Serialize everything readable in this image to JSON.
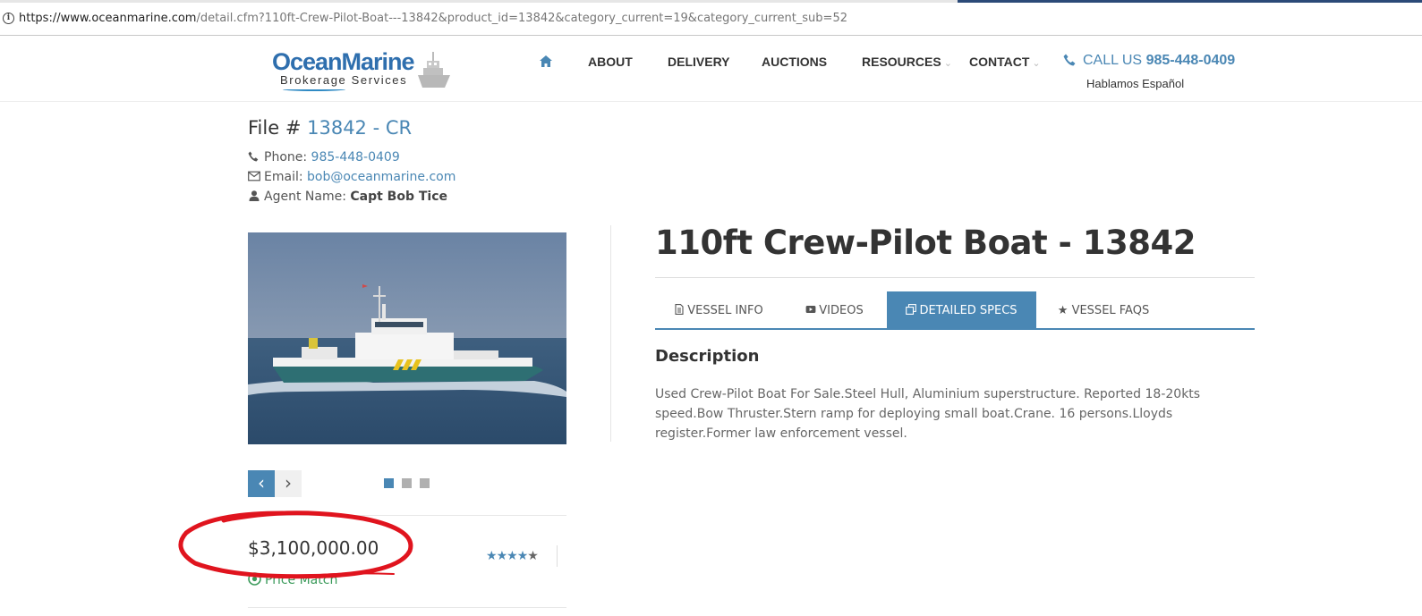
{
  "browser": {
    "url_host": "https://www.oceanmarine.com",
    "url_path": "/detail.cfm?110ft-Crew-Pilot-Boat---13842&product_id=13842&category_current=19&category_current_sub=52"
  },
  "header": {
    "logo_brand": "OceanMarine",
    "logo_sub": "Brokerage Services",
    "nav": [
      {
        "label": "ABOUT"
      },
      {
        "label": "DELIVERY"
      },
      {
        "label": "AUCTIONS"
      },
      {
        "label": "RESOURCES"
      },
      {
        "label": "CONTACT"
      }
    ],
    "call_label": "CALL US",
    "call_number": "985-448-0409",
    "hablamos": "Hablamos Español"
  },
  "file": {
    "prefix": "File #",
    "number": "13842 - CR",
    "phone_label": "Phone:",
    "phone": "985-448-0409",
    "email_label": "Email:",
    "email": "bob@oceanmarine.com",
    "agent_label": "Agent Name:",
    "agent": "Capt Bob Tice"
  },
  "gallery": {
    "prev_icon": "chevron-left-icon",
    "next_icon": "chevron-right-icon",
    "current_slide": 1,
    "total_slides": 3
  },
  "pricing": {
    "price": "$3,100,000.00",
    "price_match": "Price Match",
    "rating": 4
  },
  "vessel": {
    "title": "110ft Crew-Pilot Boat - 13842",
    "tabs": [
      {
        "label": "VESSEL INFO",
        "icon": "document-icon"
      },
      {
        "label": "VIDEOS",
        "icon": "video-icon"
      },
      {
        "label": "DETAILED SPECS",
        "icon": "copy-icon"
      },
      {
        "label": "VESSEL FAQS",
        "icon": "star-icon"
      }
    ],
    "active_tab": "DETAILED SPECS",
    "description_title": "Description",
    "description": "Used Crew-Pilot Boat For Sale.Steel Hull, Aluminium superstructure. Reported 18-20kts speed.Bow Thruster.Stern ramp for deploying small boat.Crane. 16 persons.Lloyds register.Former law enforcement vessel."
  },
  "colors": {
    "accent": "#4a87b4",
    "annotation": "#e0141e",
    "text": "#333333"
  }
}
